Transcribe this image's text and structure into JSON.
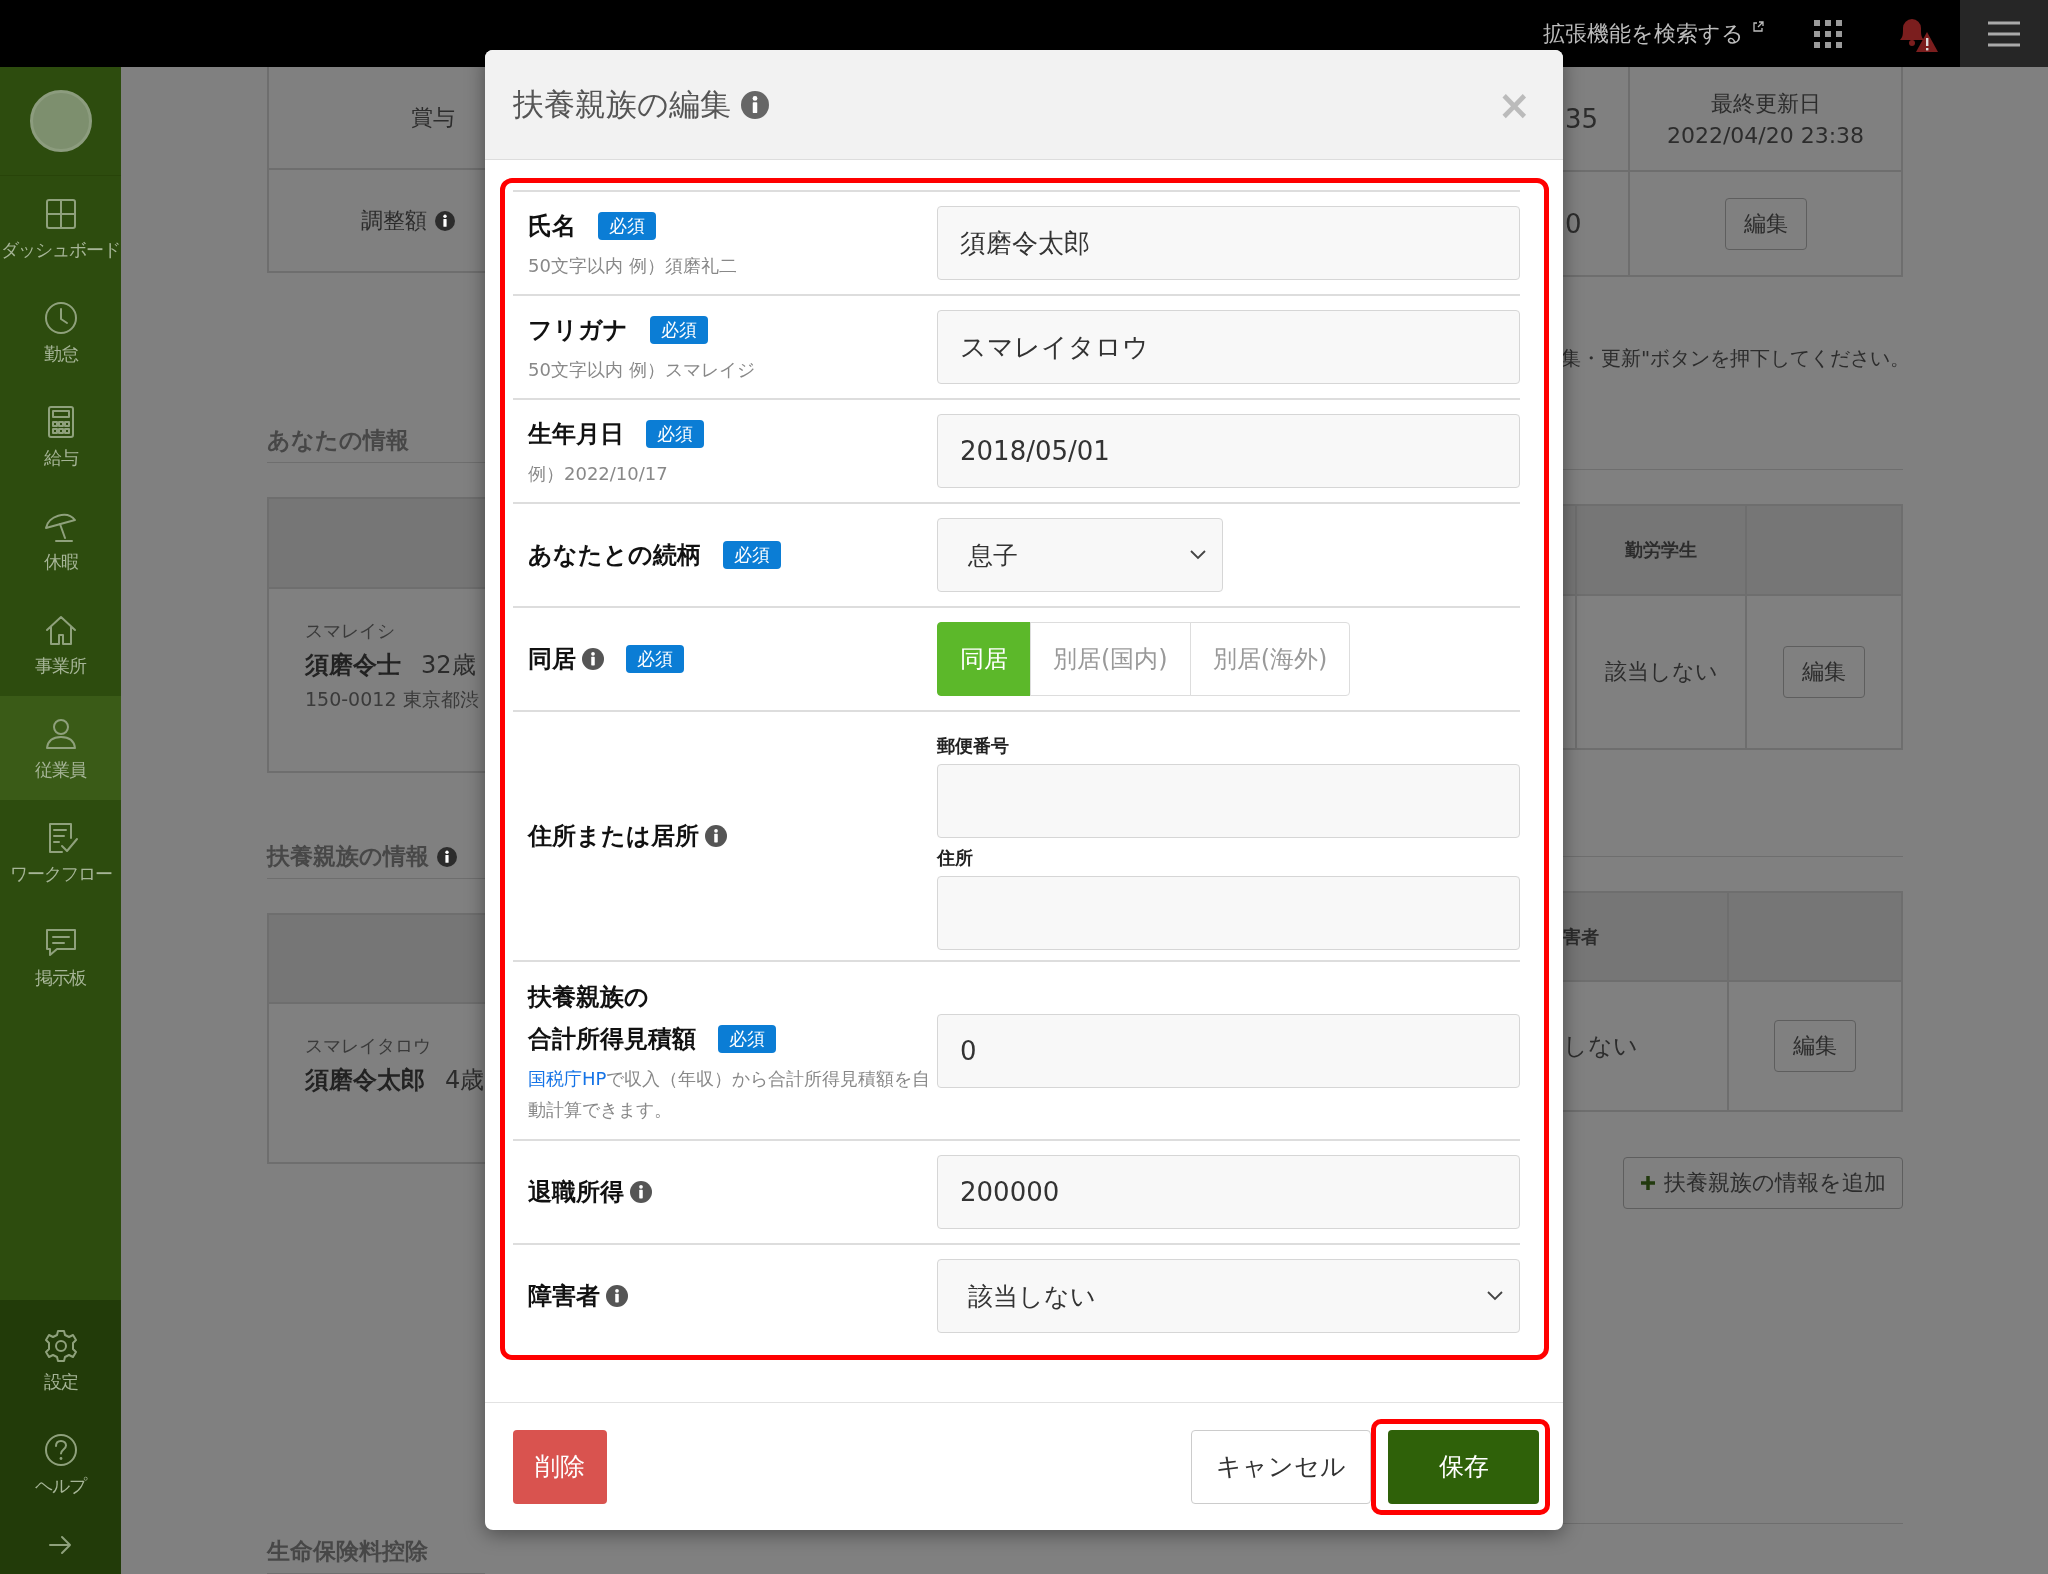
{
  "top_bar": {
    "extension_link": "拡張機能を検索する"
  },
  "sidebar": {
    "items": [
      {
        "label": "ダッシュボード",
        "selected": false
      },
      {
        "label": "勤怠",
        "selected": false
      },
      {
        "label": "給与",
        "selected": false
      },
      {
        "label": "休暇",
        "selected": false
      },
      {
        "label": "事業所",
        "selected": false
      },
      {
        "label": "従業員",
        "selected": true
      },
      {
        "label": "ワークフロー",
        "selected": false
      },
      {
        "label": "掲示板",
        "selected": false
      }
    ],
    "bottom_items": [
      {
        "label": "設定"
      },
      {
        "label": "ヘルプ"
      }
    ]
  },
  "background": {
    "summary_table": {
      "rows": [
        {
          "label": "賞与",
          "info": false,
          "value": "35"
        },
        {
          "label": "調整額",
          "info": true,
          "value": "0"
        }
      ],
      "last_updated_label": "最終更新日",
      "last_updated": "2022/04/20 23:38",
      "edit_button": "編集"
    },
    "notice": "集・更新\"ボタンを押下してください。",
    "your_info": {
      "heading": "あなたの情報",
      "info": false,
      "column_header": "勤労学生",
      "row": {
        "kana": "スマレイシ",
        "name": "須磨令士",
        "age": "32歳",
        "address": "150-0012 東京都渋",
        "status": "該当しない",
        "edit_button": "編集"
      }
    },
    "dependents_info": {
      "heading": "扶養親族の情報",
      "info": true,
      "column_header": "害者",
      "row": {
        "kana": "スマレイタロウ",
        "name": "須磨令太郎",
        "age": "4歳",
        "status": "しない",
        "edit_button": "編集"
      },
      "add_button": "扶養親族の情報を追加"
    },
    "next_heading": "生命保険料控除"
  },
  "dialog": {
    "title": "扶養親族の編集",
    "info": true,
    "close": "×",
    "highlighted": true,
    "fields": [
      {
        "kind": "text",
        "label_lines": [
          "氏名"
        ],
        "info": false,
        "badge": "必須",
        "hint": "50文字以内 例）須磨礼二",
        "value": "須磨令太郎"
      },
      {
        "kind": "text",
        "label_lines": [
          "フリガナ"
        ],
        "info": false,
        "badge": "必須",
        "hint": "50文字以内 例）スマレイジ",
        "value": "スマレイタロウ"
      },
      {
        "kind": "text",
        "label_lines": [
          "生年月日"
        ],
        "info": false,
        "badge": "必須",
        "hint": "例）2022/10/17",
        "value": "2018/05/01"
      },
      {
        "kind": "short_select",
        "label_lines": [
          "あなたとの続柄"
        ],
        "info": false,
        "badge": "必須",
        "value": "息子"
      },
      {
        "kind": "segmented",
        "label_lines": [
          "同居"
        ],
        "info": true,
        "badge": "必須",
        "options": [
          {
            "label": "同居",
            "selected": true
          },
          {
            "label": "別居(国内)",
            "selected": false
          },
          {
            "label": "別居(海外)",
            "selected": false
          }
        ]
      },
      {
        "kind": "address",
        "label_lines": [
          "住所または居所"
        ],
        "info": true,
        "subfields": [
          {
            "label": "郵便番号"
          },
          {
            "label": "住所"
          }
        ]
      },
      {
        "kind": "text",
        "label_lines": [
          "扶養親族の",
          "合計所得見積額"
        ],
        "info": false,
        "badge": "必須",
        "hint_link": "国税庁HP",
        "hint": "で収入（年収）から合計所得見積額を自動計算できます。",
        "value": "0"
      },
      {
        "kind": "text",
        "label_lines": [
          "退職所得"
        ],
        "info": true,
        "value": "200000"
      },
      {
        "kind": "select",
        "label_lines": [
          "障害者"
        ],
        "info": true,
        "value": "該当しない"
      }
    ],
    "footer": {
      "delete": "削除",
      "cancel": "キャンセル",
      "save": "保存",
      "save_highlighted": true
    }
  }
}
